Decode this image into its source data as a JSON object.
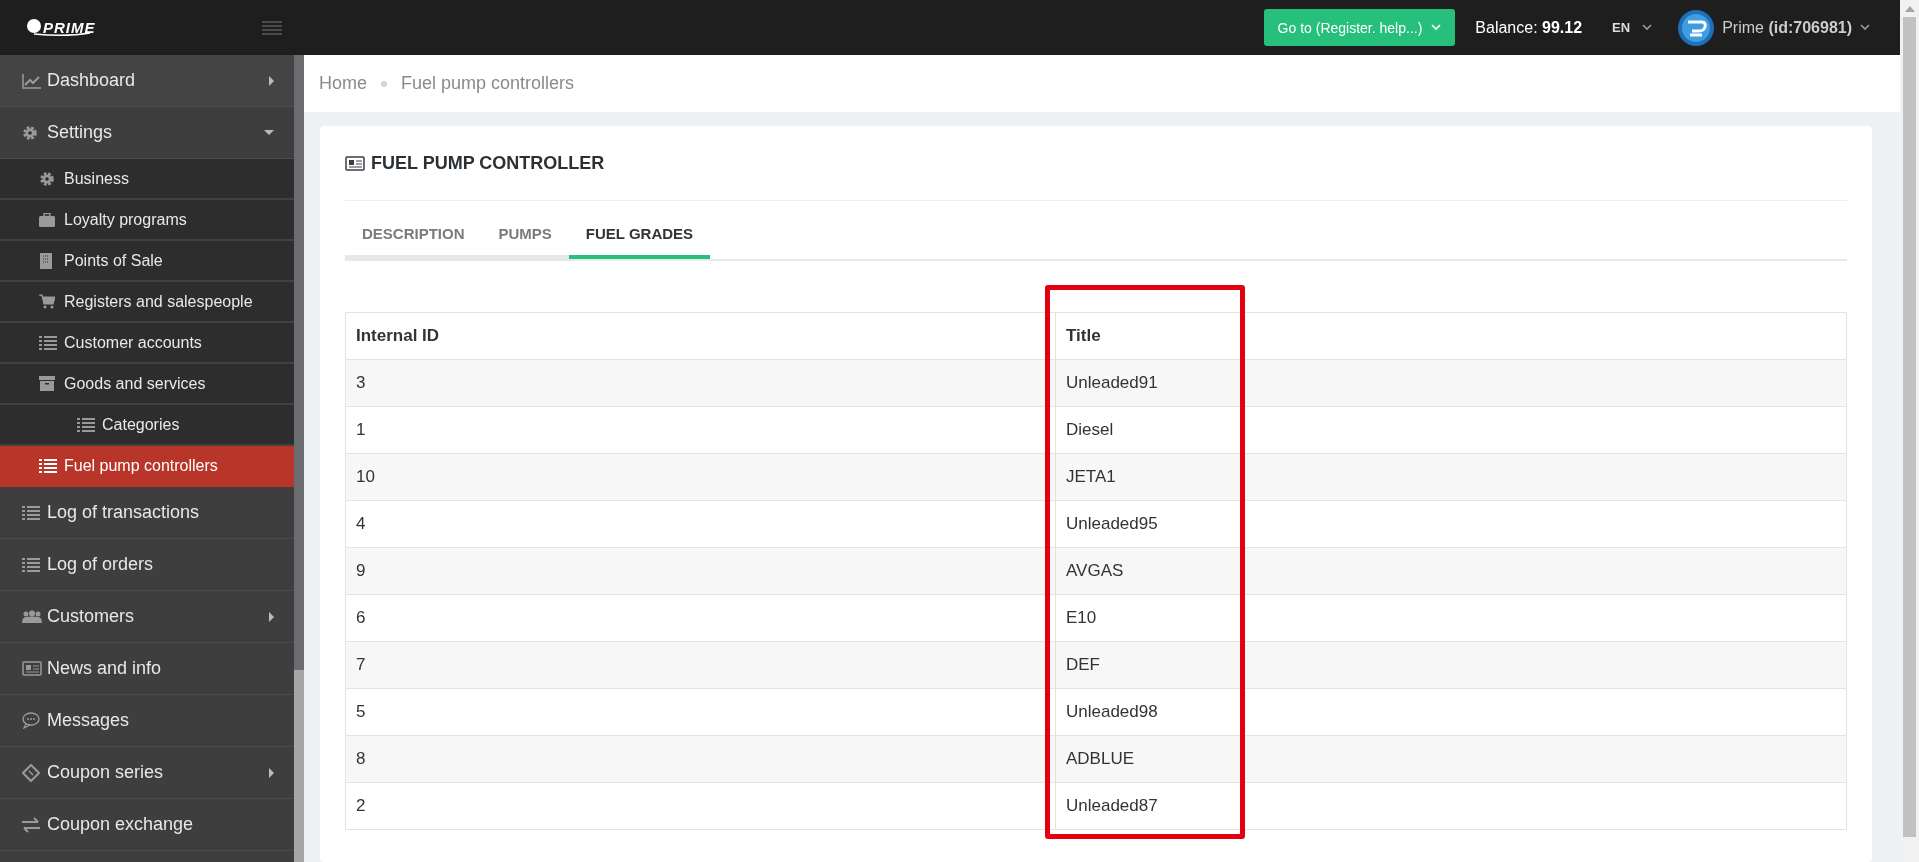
{
  "topbar": {
    "logo": "PRIME",
    "goto_button": "Go to (Register. help...)",
    "balance_label": "Balance:",
    "balance_value": "99.12",
    "language": "EN",
    "user_name": "Prime",
    "user_id": "(id:706981)"
  },
  "sidebar": {
    "items": [
      {
        "label": "Dashboard",
        "selected": false,
        "expanded": false
      },
      {
        "label": "Settings",
        "selected": false,
        "expanded": true,
        "children": [
          {
            "label": "Business",
            "selected": false
          },
          {
            "label": "Loyalty programs",
            "selected": false
          },
          {
            "label": "Points of Sale",
            "selected": false
          },
          {
            "label": "Registers and salespeople",
            "selected": false
          },
          {
            "label": "Customer accounts",
            "selected": false
          },
          {
            "label": "Goods and services",
            "selected": false,
            "children": [
              {
                "label": "Categories",
                "selected": false
              }
            ]
          },
          {
            "label": "Fuel pump controllers",
            "selected": true
          }
        ]
      },
      {
        "label": "Log of transactions",
        "selected": false
      },
      {
        "label": "Log of orders",
        "selected": false
      },
      {
        "label": "Customers",
        "selected": false,
        "expanded": false
      },
      {
        "label": "News and info",
        "selected": false
      },
      {
        "label": "Messages",
        "selected": false
      },
      {
        "label": "Coupon series",
        "selected": false,
        "expanded": false
      },
      {
        "label": "Coupon exchange",
        "selected": false
      }
    ]
  },
  "breadcrumb": [
    "Home",
    "Fuel pump controllers"
  ],
  "card": {
    "title": "FUEL PUMP CONTROLLER",
    "tabs": [
      {
        "label": "DESCRIPTION",
        "selected": false
      },
      {
        "label": "PUMPS",
        "selected": false
      },
      {
        "label": "FUEL GRADES",
        "selected": true
      }
    ],
    "table": {
      "columns": [
        "Internal ID",
        "Title"
      ],
      "rows": [
        [
          "3",
          "Unleaded91"
        ],
        [
          "1",
          "Diesel"
        ],
        [
          "10",
          "JETA1"
        ],
        [
          "4",
          "Unleaded95"
        ],
        [
          "9",
          "AVGAS"
        ],
        [
          "6",
          "E10"
        ],
        [
          "7",
          "DEF"
        ],
        [
          "5",
          "Unleaded98"
        ],
        [
          "8",
          "ADBLUE"
        ],
        [
          "2",
          "Unleaded87"
        ]
      ]
    }
  }
}
